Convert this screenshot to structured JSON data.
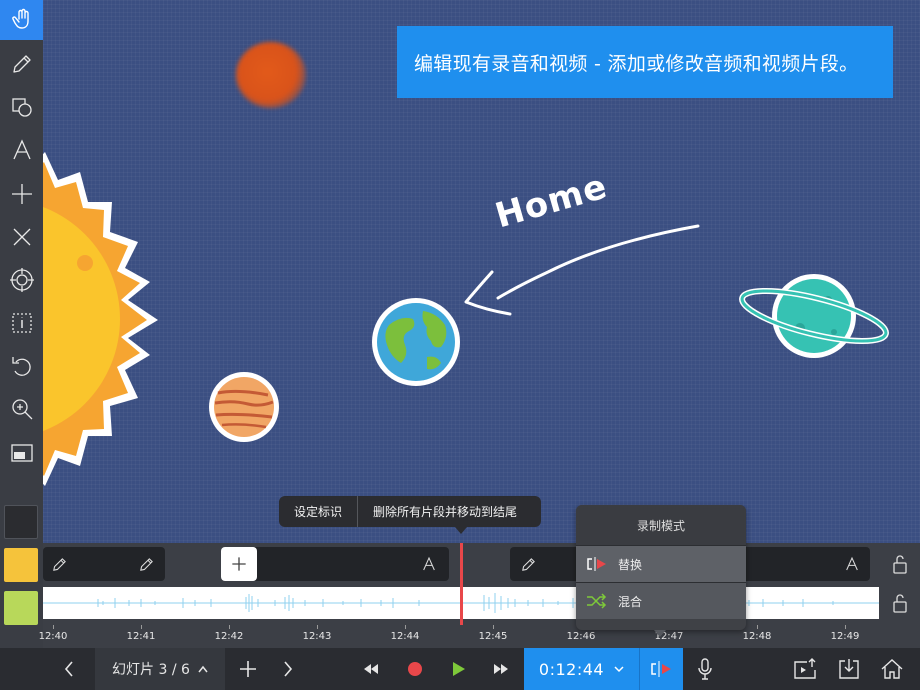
{
  "banner": {
    "text": "编辑现有录音和视频 - 添加或修改音频和视频片段。"
  },
  "canvas": {
    "annotation_text": "Home"
  },
  "toolbar": {
    "tools": [
      {
        "name": "hand-icon",
        "active": true
      },
      {
        "name": "pencil-icon"
      },
      {
        "name": "shapes-icon"
      },
      {
        "name": "text-icon"
      },
      {
        "name": "add-icon"
      },
      {
        "name": "delete-icon"
      },
      {
        "name": "laser-pointer-icon"
      },
      {
        "name": "select-icon"
      },
      {
        "name": "undo-icon"
      },
      {
        "name": "zoom-icon"
      },
      {
        "name": "background-icon"
      }
    ],
    "colors": [
      "#2b2c30",
      "#f5c33b",
      "#b8d85a"
    ]
  },
  "context_menu": {
    "items": [
      "设定标识",
      "删除所有片段并移动到结尾"
    ]
  },
  "record_mode": {
    "title": "录制模式",
    "options": [
      {
        "label": "替换",
        "selected": true
      },
      {
        "label": "混合",
        "selected": false
      }
    ]
  },
  "timeline": {
    "ticks": [
      "12:40",
      "12:41",
      "12:42",
      "12:43",
      "12:44",
      "12:45",
      "12:46",
      "12:47",
      "12:48",
      "12:49"
    ],
    "playhead_color": "#e8474a"
  },
  "bottom_bar": {
    "slide_label": "幻灯片 3 / 6",
    "time": "0:12:44"
  },
  "colors": {
    "accent": "#1f8fee",
    "canvas_bg": "#3b4f82",
    "record_red": "#e8474a",
    "play_green": "#7ec93a"
  }
}
